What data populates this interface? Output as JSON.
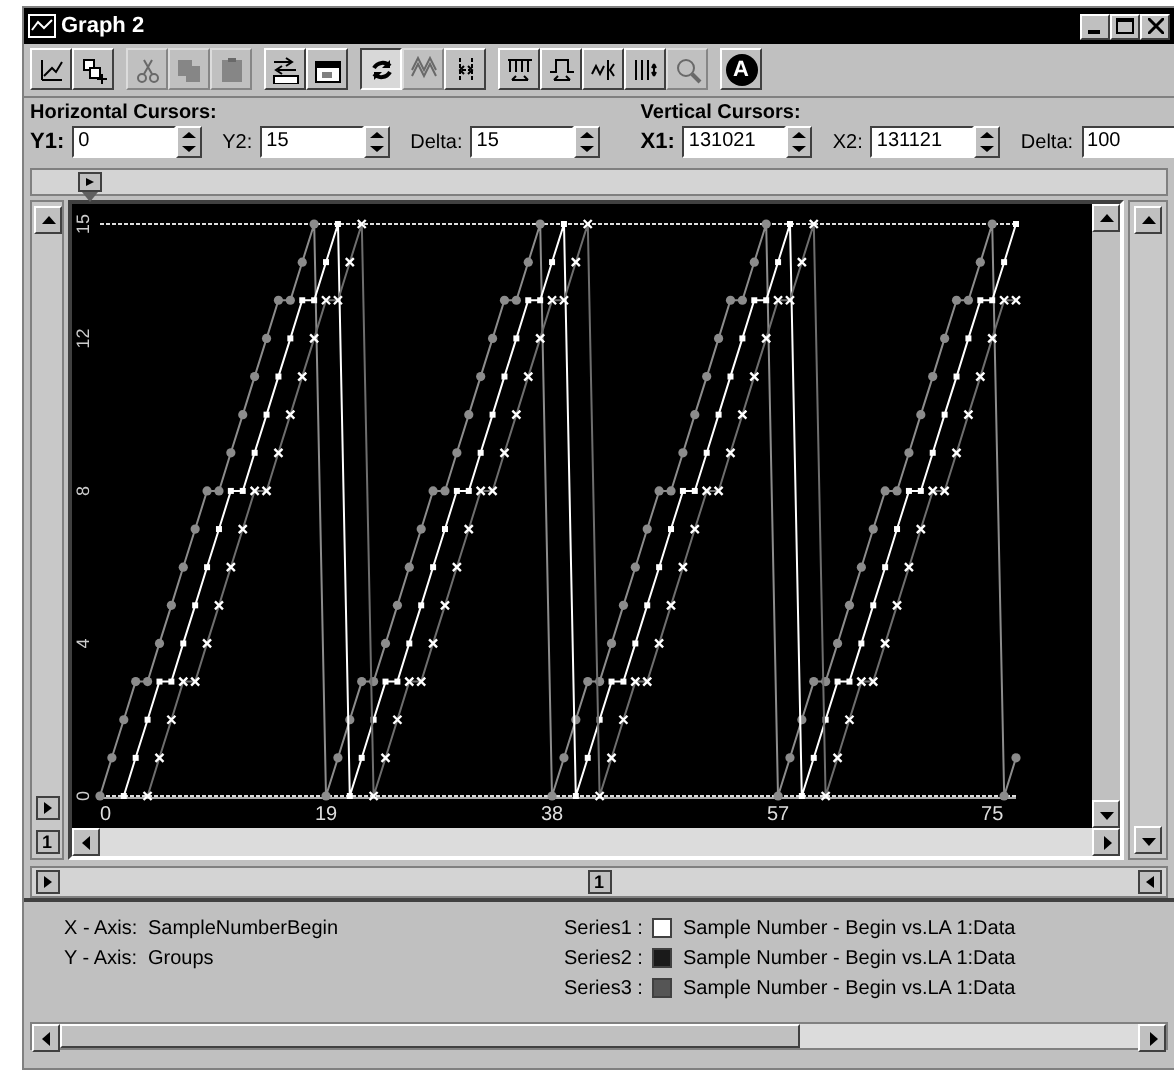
{
  "window": {
    "title": "Graph 2"
  },
  "toolbar": [
    {
      "kind": "edit",
      "disabled": false,
      "selected": false
    },
    {
      "kind": "add",
      "disabled": false,
      "selected": false
    },
    {
      "kind": "cut",
      "disabled": true,
      "selected": false
    },
    {
      "kind": "copy",
      "disabled": true,
      "selected": false
    },
    {
      "kind": "paste",
      "disabled": true,
      "selected": false
    },
    {
      "kind": "export",
      "disabled": false,
      "selected": false
    },
    {
      "kind": "properties",
      "disabled": false,
      "selected": false
    },
    {
      "kind": "refresh",
      "disabled": false,
      "selected": true
    },
    {
      "kind": "wave",
      "disabled": true,
      "selected": false
    },
    {
      "kind": "split",
      "disabled": false,
      "selected": false
    },
    {
      "kind": "comb",
      "disabled": false,
      "selected": false
    },
    {
      "kind": "pulse",
      "disabled": false,
      "selected": false
    },
    {
      "kind": "marker",
      "disabled": false,
      "selected": false
    },
    {
      "kind": "bars",
      "disabled": false,
      "selected": false
    },
    {
      "kind": "zoom",
      "disabled": true,
      "selected": false
    },
    {
      "kind": "annotate",
      "disabled": false,
      "selected": false,
      "label": "A"
    }
  ],
  "cursors": [
    {
      "title": "Horizontal Cursors:",
      "fields": [
        {
          "label": "Y1:",
          "value": "0",
          "bold": true
        },
        {
          "label": "Y2:",
          "value": "15",
          "bold": false
        },
        {
          "label": "Delta:",
          "value": "15",
          "bold": false
        }
      ]
    },
    {
      "title": "Vertical Cursors:",
      "fields": [
        {
          "label": "X1:",
          "value": "131021",
          "bold": true
        },
        {
          "label": "X2:",
          "value": "131121",
          "bold": false
        },
        {
          "label": "Delta:",
          "value": "100",
          "bold": false
        }
      ]
    }
  ],
  "left_marker": "1",
  "bottom_marker": "1",
  "chart": {
    "chart_data": {
      "type": "line",
      "xlim": [
        0,
        77
      ],
      "ylim": [
        0,
        15
      ],
      "xticks": [
        0,
        19,
        38,
        57,
        75
      ],
      "yticks": [
        0,
        4,
        8,
        12,
        15
      ],
      "x": [
        0,
        1,
        2,
        3,
        4,
        5,
        6,
        7,
        8,
        9,
        10,
        11,
        12,
        13,
        14,
        15,
        16,
        17,
        18,
        19,
        20,
        21,
        22,
        23,
        24,
        25,
        26,
        27,
        28,
        29,
        30,
        31,
        32,
        33,
        34,
        35,
        36,
        37,
        38,
        39,
        40,
        41,
        42,
        43,
        44,
        45,
        46,
        47,
        48,
        49,
        50,
        51,
        52,
        53,
        54,
        55,
        56,
        57,
        58,
        59,
        60,
        61,
        62,
        63,
        64,
        65,
        66,
        67,
        68,
        69,
        70,
        71,
        72,
        73,
        74,
        75,
        76,
        77
      ],
      "series": [
        {
          "color": "#8c8c8c",
          "marker": "circle",
          "values": [
            0,
            1,
            2,
            3,
            3,
            4,
            5,
            6,
            7,
            8,
            8,
            9,
            10,
            11,
            12,
            13,
            13,
            14,
            15,
            0,
            1,
            2,
            3,
            3,
            4,
            5,
            6,
            7,
            8,
            8,
            9,
            10,
            11,
            12,
            13,
            13,
            14,
            15,
            0,
            1,
            2,
            3,
            3,
            4,
            5,
            6,
            7,
            8,
            8,
            9,
            10,
            11,
            12,
            13,
            13,
            14,
            15,
            0,
            1,
            2,
            3,
            3,
            4,
            5,
            6,
            7,
            8,
            8,
            9,
            10,
            11,
            12,
            13,
            13,
            14,
            15,
            0,
            1
          ]
        },
        {
          "color": "#ffffff",
          "marker": "square",
          "values": [
            null,
            null,
            0,
            1,
            2,
            3,
            3,
            4,
            5,
            6,
            7,
            8,
            8,
            9,
            10,
            11,
            12,
            13,
            13,
            14,
            15,
            0,
            1,
            2,
            3,
            3,
            4,
            5,
            6,
            7,
            8,
            8,
            9,
            10,
            11,
            12,
            13,
            13,
            14,
            15,
            0,
            1,
            2,
            3,
            3,
            4,
            5,
            6,
            7,
            8,
            8,
            9,
            10,
            11,
            12,
            13,
            13,
            14,
            15,
            0,
            1,
            2,
            3,
            3,
            4,
            5,
            6,
            7,
            8,
            8,
            9,
            10,
            11,
            12,
            13,
            13,
            14,
            15
          ]
        },
        {
          "color": "#6e6e6e",
          "marker": "cross",
          "values": [
            null,
            null,
            null,
            null,
            0,
            1,
            2,
            3,
            3,
            4,
            5,
            6,
            7,
            8,
            8,
            9,
            10,
            11,
            12,
            13,
            13,
            14,
            15,
            0,
            1,
            2,
            3,
            3,
            4,
            5,
            6,
            7,
            8,
            8,
            9,
            10,
            11,
            12,
            13,
            13,
            14,
            15,
            0,
            1,
            2,
            3,
            3,
            4,
            5,
            6,
            7,
            8,
            8,
            9,
            10,
            11,
            12,
            13,
            13,
            14,
            15,
            0,
            1,
            2,
            3,
            3,
            4,
            5,
            6,
            7,
            8,
            8,
            9,
            10,
            11,
            12,
            13,
            13
          ]
        }
      ]
    }
  },
  "info": {
    "axes": [
      {
        "label": "X - Axis:",
        "value": "SampleNumberBegin"
      },
      {
        "label": "Y - Axis:",
        "value": "Groups"
      }
    ],
    "series": [
      {
        "label": "Series1 :",
        "color": "#ffffff",
        "name": "Sample Number - Begin vs.LA 1:Data"
      },
      {
        "label": "Series2 :",
        "color": "#1a1a1a",
        "name": "Sample Number - Begin vs.LA 1:Data"
      },
      {
        "label": "Series3 :",
        "color": "#555555",
        "name": "Sample Number - Begin vs.LA 1:Data"
      }
    ]
  }
}
